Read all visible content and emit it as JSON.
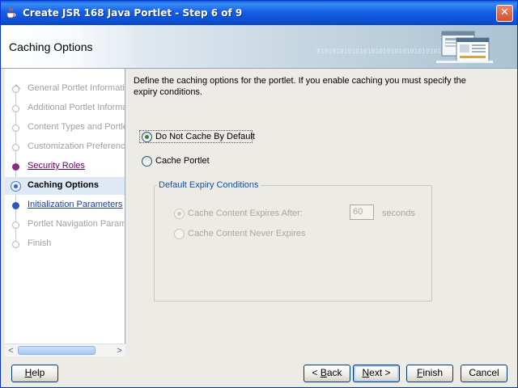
{
  "window": {
    "title": "Create JSR 168 Java Portlet - Step 6 of 9",
    "close_glyph": "✕"
  },
  "header": {
    "title": "Caching Options",
    "binary_decor": "01010101010101010101010101010101"
  },
  "nav": {
    "items": [
      {
        "label": "General Portlet Informati",
        "state": "disabled"
      },
      {
        "label": "Additional Portlet Informa",
        "state": "disabled"
      },
      {
        "label": "Content Types and Portle",
        "state": "disabled"
      },
      {
        "label": "Customization Preference",
        "state": "disabled"
      },
      {
        "label": "Security Roles",
        "state": "visited"
      },
      {
        "label": "Caching Options",
        "state": "current"
      },
      {
        "label": "Initialization Parameters",
        "state": "link"
      },
      {
        "label": "Portlet Navigation Param",
        "state": "disabled"
      },
      {
        "label": "Finish",
        "state": "disabled"
      }
    ],
    "scroll_left": "<",
    "scroll_right": ">"
  },
  "content": {
    "description": "Define the caching options for the portlet. If you enable caching you must specify the expiry conditions.",
    "do_not_cache": {
      "label": "Do Not Cache By Default",
      "selected": true
    },
    "cache_portlet": {
      "label": "Cache Portlet",
      "selected": false
    },
    "expiry_group": {
      "legend": "Default Expiry Conditions",
      "expires_after": {
        "label": "Cache Content Expires After:",
        "selected": true,
        "value": "60",
        "unit": "seconds"
      },
      "never_expires": {
        "label": "Cache Content Never Expires",
        "selected": false
      }
    }
  },
  "buttons": {
    "help": {
      "pre": "",
      "mnemonic": "H",
      "post": "elp"
    },
    "back": {
      "pre": "< ",
      "mnemonic": "B",
      "post": "ack"
    },
    "next": {
      "pre": "",
      "mnemonic": "N",
      "post": "ext >"
    },
    "finish": {
      "pre": "",
      "mnemonic": "F",
      "post": "inish"
    },
    "cancel": {
      "pre": "Cancel",
      "mnemonic": "",
      "post": ""
    }
  },
  "colors": {
    "titlebar": "#0c4fd2",
    "accent_link": "#1a3ba6",
    "visited_link": "#660066",
    "group_legend": "#1550a6"
  }
}
